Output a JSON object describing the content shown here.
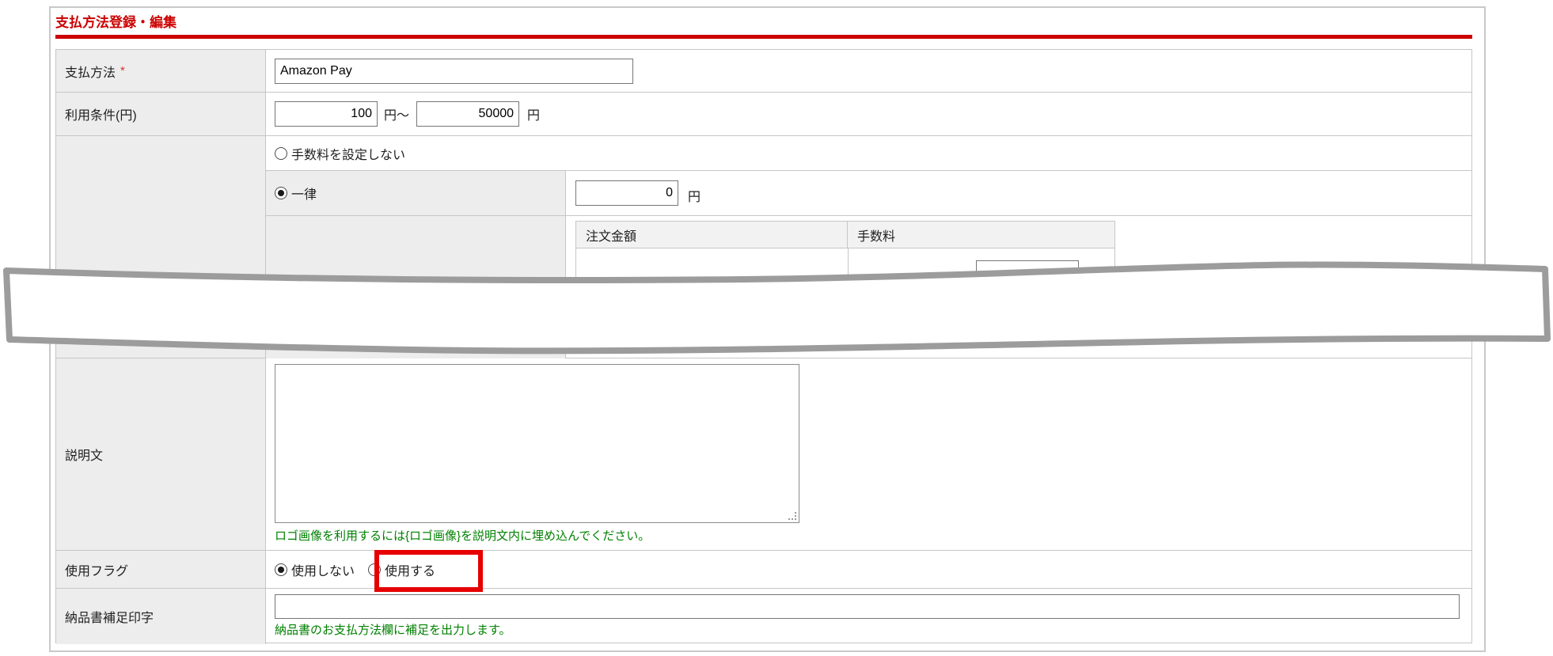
{
  "page": {
    "title": "支払方法登録・編集"
  },
  "form": {
    "payment_method": {
      "label": "支払方法",
      "required_mark": "*",
      "value": "Amazon Pay"
    },
    "usage_condition": {
      "label": "利用条件(円)",
      "min_value": "100",
      "range_unit": "円～",
      "max_value": "50000",
      "unit": "円"
    },
    "fee": {
      "no_fee_option": "手数料を設定しない",
      "flat_option": "一律",
      "flat_value": "0",
      "flat_unit": "円",
      "selected_option": "一律",
      "tiers_table": {
        "headers": {
          "order_amount": "注文金額",
          "fee": "手数料"
        }
      }
    },
    "description": {
      "label": "説明文",
      "value": "",
      "hint": "ロゴ画像を利用するには{ロゴ画像}を説明文内に埋め込んでください。"
    },
    "use_flag": {
      "label": "使用フラグ",
      "option_off": "使用しない",
      "option_on": "使用する",
      "selected": "使用しない"
    },
    "delivery_note": {
      "label": "納品書補足印字",
      "value": "",
      "hint": "納品書のお支払方法欄に補足を出力します。"
    }
  },
  "colors": {
    "accent_red": "#cc0000",
    "annotation_red": "#e60000",
    "hint_green": "#008000",
    "label_cell_bg": "#ededed",
    "border_gray": "#c6c6c6"
  }
}
